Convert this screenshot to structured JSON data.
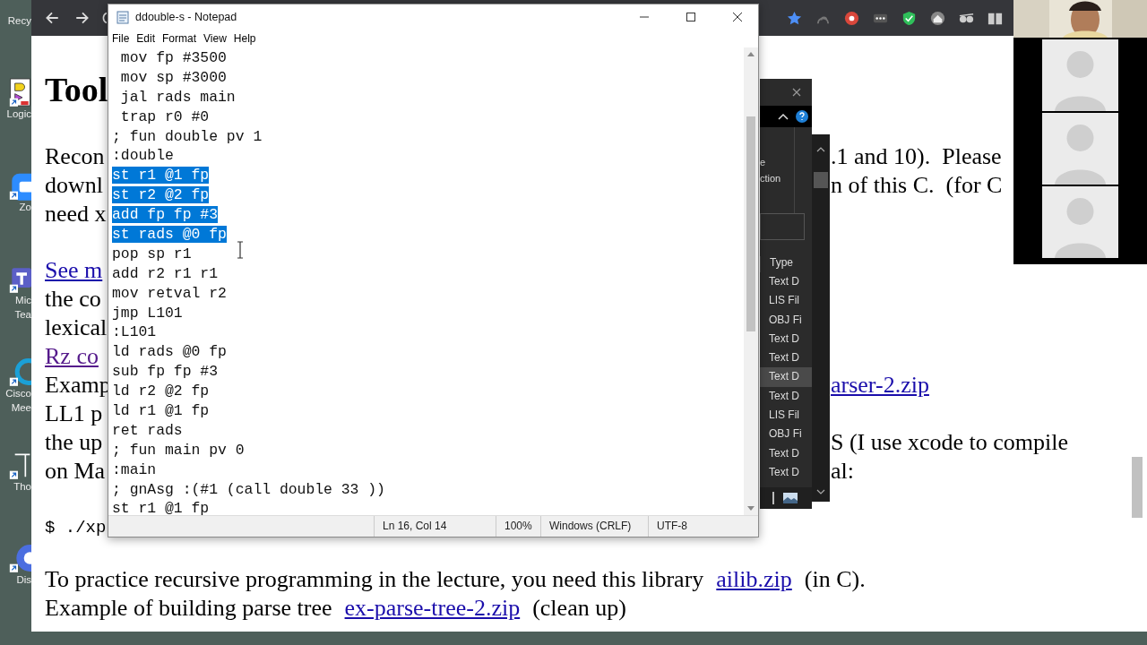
{
  "desktop_icons": [
    {
      "kind": "recycle",
      "label": "Recy"
    },
    {
      "kind": "logic",
      "label": "Logic"
    },
    {
      "kind": "zoom",
      "label": "Zo"
    },
    {
      "kind": "teams",
      "label": "Mic\nTea"
    },
    {
      "kind": "cisco",
      "label": "Cisco\nMee"
    },
    {
      "kind": "pen",
      "label": "Tho"
    },
    {
      "kind": "discord",
      "label": "Dis"
    }
  ],
  "browser": {
    "toolbar_icons": [
      {
        "kind": "back"
      },
      {
        "kind": "forward"
      },
      {
        "kind": "reload"
      }
    ],
    "extension_icons": [
      {
        "kind": "star"
      },
      {
        "kind": "swirl"
      },
      {
        "kind": "record"
      },
      {
        "kind": "more"
      },
      {
        "kind": "shield"
      },
      {
        "kind": "house"
      },
      {
        "kind": "glasses"
      },
      {
        "kind": "book"
      }
    ],
    "page": {
      "heading": "Tool",
      "blocks": [
        {
          "lines": [
            {
              "left": {
                "text": "Recon",
                "kind": "text"
              },
              "right": {
                "text": ".1 and 10).  Please",
                "kind": "text"
              }
            },
            {
              "left": {
                "text": "downl",
                "kind": "text"
              },
              "right": {
                "text": "n of this C.  (for C",
                "kind": "text"
              }
            },
            {
              "left": {
                "text": "need x",
                "kind": "text"
              }
            }
          ]
        },
        {
          "lines": [
            {
              "left": {
                "text": "See m",
                "kind": "link"
              }
            },
            {
              "left": {
                "text": "the co",
                "kind": "text"
              }
            },
            {
              "left": {
                "text": "lexical",
                "kind": "text"
              }
            },
            {
              "left": {
                "text": "Rz co",
                "kind": "visited"
              }
            },
            {
              "left": {
                "text": "Examp",
                "kind": "text"
              },
              "right": {
                "text": "arser-2.zip",
                "kind": "link"
              }
            },
            {
              "left": {
                "text": "LL1 p",
                "kind": "text"
              }
            },
            {
              "left": {
                "text": "the up",
                "kind": "text"
              },
              "right": {
                "text": "S (I use xcode to compile",
                "kind": "text"
              }
            },
            {
              "left": {
                "text": "on Ma",
                "kind": "text"
              },
              "right": {
                "text": "al:",
                "kind": "text"
              }
            }
          ]
        },
        {
          "lines": [
            {
              "left": {
                "text": "$ ./xp",
                "kind": "code"
              }
            }
          ]
        }
      ],
      "paragraphs": [
        {
          "parts": [
            {
              "text": "To practice recursive programming in the lecture, you need this library",
              "kind": "text"
            },
            {
              "text": "ailib.zip",
              "kind": "link"
            },
            {
              "text": "(in C).",
              "kind": "text"
            }
          ]
        },
        {
          "parts": [
            {
              "text": "Example of building parse tree",
              "kind": "text"
            },
            {
              "text": "ex-parse-tree-2.zip",
              "kind": "link"
            },
            {
              "text": "(clean up)",
              "kind": "text"
            }
          ]
        }
      ]
    }
  },
  "explorer": {
    "ribbon_texts": [
      "e",
      "ction"
    ],
    "column": "Type",
    "items": [
      {
        "text": "Text D",
        "selected": false
      },
      {
        "text": "LIS Fil",
        "selected": false
      },
      {
        "text": "OBJ Fi",
        "selected": false
      },
      {
        "text": "Text D",
        "selected": false
      },
      {
        "text": "Text D",
        "selected": false
      },
      {
        "text": "Text D",
        "selected": true
      },
      {
        "text": "Text D",
        "selected": false
      },
      {
        "text": "LIS Fil",
        "selected": false
      },
      {
        "text": "OBJ Fi",
        "selected": false
      },
      {
        "text": "Text D",
        "selected": false
      },
      {
        "text": "Text D",
        "selected": false
      }
    ]
  },
  "notepad": {
    "title": "ddouble-s - Notepad",
    "menu": [
      "File",
      "Edit",
      "Format",
      "View",
      "Help"
    ],
    "lines": [
      {
        "text": " mov fp #3500",
        "selected": false
      },
      {
        "text": " mov sp #3000",
        "selected": false
      },
      {
        "text": " jal rads main",
        "selected": false
      },
      {
        "text": " trap r0 #0",
        "selected": false
      },
      {
        "text": "; fun double pv 1",
        "selected": false
      },
      {
        "text": ":double",
        "selected": false
      },
      {
        "text": "st r1 @1 fp",
        "selected": true
      },
      {
        "text": "st r2 @2 fp",
        "selected": true
      },
      {
        "text": "add fp fp #3",
        "selected": true
      },
      {
        "text": "st rads @0 fp",
        "selected": true
      },
      {
        "text": "pop sp r1",
        "selected": false
      },
      {
        "text": "add r2 r1 r1",
        "selected": false
      },
      {
        "text": "mov retval r2",
        "selected": false
      },
      {
        "text": "jmp L101",
        "selected": false
      },
      {
        "text": ":L101",
        "selected": false
      },
      {
        "text": "ld rads @0 fp",
        "selected": false
      },
      {
        "text": "sub fp fp #3",
        "selected": false
      },
      {
        "text": "ld r2 @2 fp",
        "selected": false
      },
      {
        "text": "ld r1 @1 fp",
        "selected": false
      },
      {
        "text": "ret rads",
        "selected": false
      },
      {
        "text": "; fun main pv 0",
        "selected": false
      },
      {
        "text": ":main",
        "selected": false
      },
      {
        "text": "; gnAsg :(#1 (call double 33 ))",
        "selected": false
      },
      {
        "text": "st r1 @1 fp",
        "selected": false
      }
    ],
    "status": [
      "Ln 16, Col 14",
      "100%",
      "Windows (CRLF)",
      "UTF-8"
    ]
  },
  "video_call": {
    "tiles": [
      {
        "kind": "camera"
      },
      {
        "kind": "avatar"
      },
      {
        "kind": "avatar"
      },
      {
        "kind": "avatar"
      }
    ]
  }
}
